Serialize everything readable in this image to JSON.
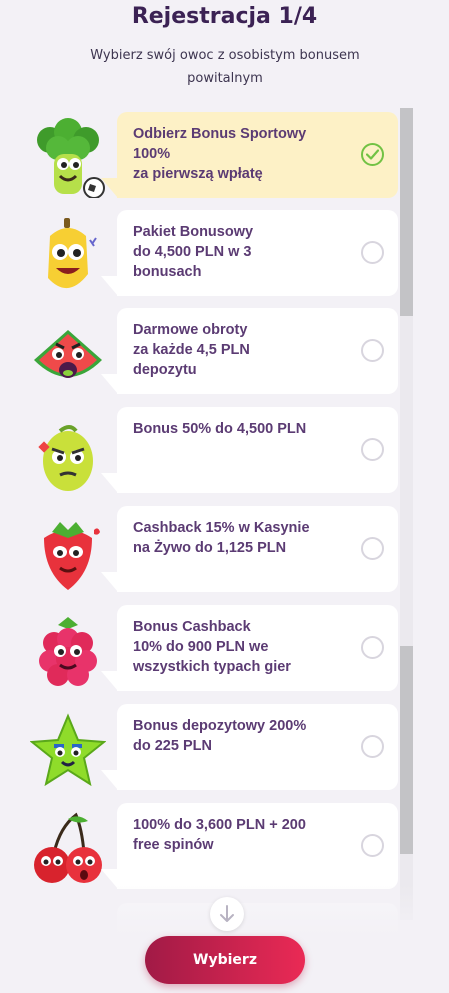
{
  "header": {
    "title": "Rejestracja 1/4",
    "subtitle": "Wybierz swój owoc z osobistym bonusem powitalnym"
  },
  "offers": [
    {
      "fruit": "broccoli-icon",
      "lines": [
        "Odbierz Bonus Sportowy",
        "100%",
        "za pierwszą wpłatę"
      ],
      "selected": true
    },
    {
      "fruit": "banana-icon",
      "lines": [
        "Pakiet Bonusowy",
        "do 4,500 PLN w 3",
        "bonusach"
      ],
      "selected": false
    },
    {
      "fruit": "watermelon-icon",
      "lines": [
        "Darmowe obroty",
        "za każde 4,5 PLN",
        "depozytu"
      ],
      "selected": false
    },
    {
      "fruit": "lemon-icon",
      "lines": [
        "Bonus 50% do 4,500 PLN"
      ],
      "selected": false
    },
    {
      "fruit": "strawberry-icon",
      "lines": [
        "Cashback 15% w Kasynie",
        "na Żywo do 1,125 PLN"
      ],
      "selected": false
    },
    {
      "fruit": "raspberry-icon",
      "lines": [
        "Bonus Cashback",
        "10% do 900 PLN we",
        "wszystkich typach gier"
      ],
      "selected": false
    },
    {
      "fruit": "star-fruit-icon",
      "lines": [
        "Bonus depozytowy 200%",
        "do 225 PLN"
      ],
      "selected": false
    },
    {
      "fruit": "cherry-icon",
      "lines": [
        "100% do 3,600 PLN + 200",
        "free spinów"
      ],
      "selected": false
    }
  ],
  "cta": {
    "label": "Wybierz"
  },
  "colors": {
    "accent_start": "#a11a46",
    "accent_end": "#ea2a55",
    "selected_card": "#fdf1c6",
    "check": "#72c244"
  }
}
